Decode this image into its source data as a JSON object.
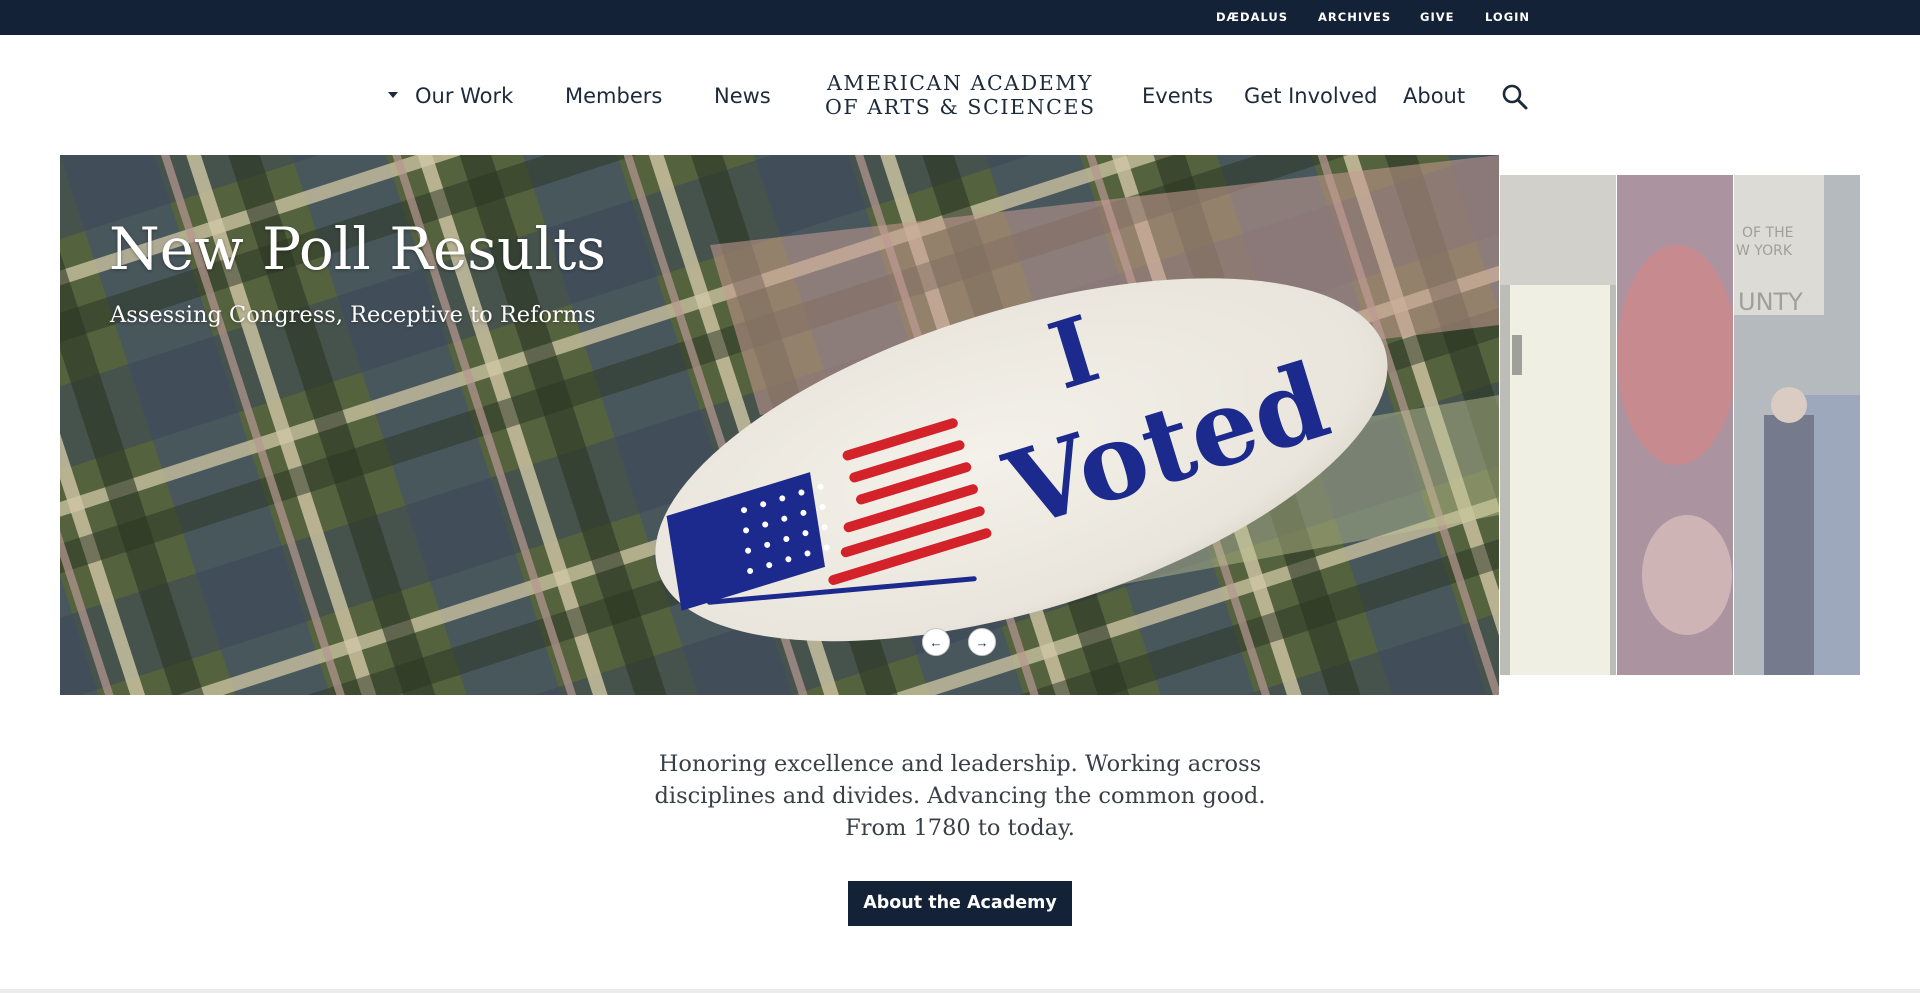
{
  "utility_nav": {
    "items": [
      "DÆDALUS",
      "ARCHIVES",
      "GIVE",
      "LOGIN"
    ]
  },
  "main_nav": {
    "left": [
      "Our Work",
      "Members",
      "News"
    ],
    "right": [
      "Events",
      "Get Involved",
      "About"
    ],
    "search_icon": "search-icon"
  },
  "logo": {
    "line1": "AMERICAN ACADEMY",
    "line2": "OF ARTS & SCIENCES"
  },
  "hero": {
    "title": "New Poll Results",
    "subtitle": "Assessing Congress, Receptive to Reforms",
    "sticker_line1": "I",
    "sticker_line2": "Voted",
    "prev_icon": "←",
    "next_icon": "→"
  },
  "intro": {
    "line1": "Honoring excellence and leadership. Working across",
    "line2": "disciplines and divides. Advancing the common good.",
    "line3": "From 1780 to today.",
    "cta_label": "About the Academy"
  },
  "colors": {
    "navy": "#132236",
    "text": "#1c2a3a",
    "sticker_blue": "#1b2a8c",
    "sticker_red": "#d3222a"
  }
}
